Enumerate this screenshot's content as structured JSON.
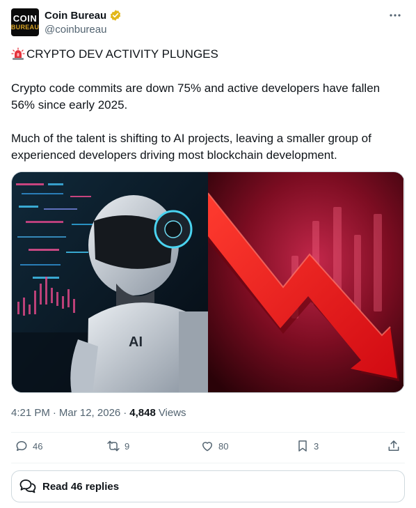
{
  "author": {
    "display_name": "Coin Bureau",
    "handle": "@coinbureau",
    "avatar_line1": "COIN",
    "avatar_line2": "BUREAU",
    "verified": true,
    "verified_color": "#e2b719"
  },
  "tweet": {
    "alert_emoji_icon": "police-light-icon",
    "headline": "CRYPTO DEV ACTIVITY PLUNGES",
    "paragraph1": "Crypto code commits are down 75% and active developers have fallen 56% since early 2025.",
    "paragraph2": "Much of the talent is shifting to AI projects, leaving a smaller group of experienced developers driving most blockchain development.",
    "time": "4:21 PM",
    "date": "Mar 12, 2026",
    "views_count": "4,848",
    "views_label": "Views"
  },
  "media": {
    "left_image": "robot-with-trading-charts",
    "right_image": "red-downward-arrow",
    "robot_chest_text": "AI"
  },
  "actions": {
    "replies": "46",
    "reposts": "9",
    "likes": "80",
    "bookmarks": "3"
  },
  "read_replies_label": "Read 46 replies",
  "colors": {
    "text_primary": "#0f1419",
    "text_secondary": "#536471",
    "border": "#cfd9de",
    "arrow_red": "#e3101a"
  }
}
